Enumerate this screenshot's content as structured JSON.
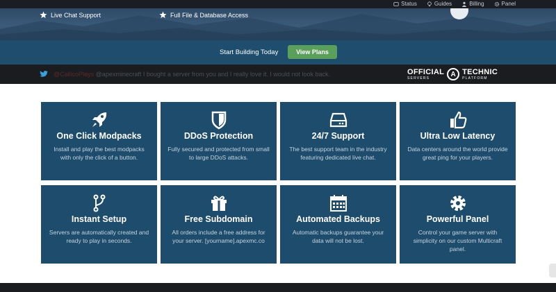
{
  "topnav": {
    "items": [
      {
        "label": "Status",
        "icon": "status-icon"
      },
      {
        "label": "Guides",
        "icon": "lightbulb-icon"
      },
      {
        "label": "Billing",
        "icon": "user-icon"
      },
      {
        "label": "Panel",
        "icon": "gear-icon"
      }
    ]
  },
  "hero": {
    "features": [
      {
        "label": "Live Chat Support",
        "icon": "star-icon"
      },
      {
        "label": "Full File & Database Access",
        "icon": "star-icon"
      }
    ]
  },
  "cta": {
    "text": "Start Building Today",
    "button_label": "View Plans",
    "button_color": "#5aa05a"
  },
  "tweet": {
    "handle": "@CallicoPlays",
    "text": "@apexminecraft I bought a server from you and I really love it. I would not look back."
  },
  "brand": {
    "word1": "OFFICIAL",
    "word1_sub": "SERVERS",
    "badge": "A",
    "word2": "TECHNIC",
    "word2_sub": "PLATFORM"
  },
  "features": [
    {
      "title": "One Click Modpacks",
      "desc": "Install and play the best modpacks with only the click of a button.",
      "icon": "rocket-icon"
    },
    {
      "title": "DDoS Protection",
      "desc": "Fully secured and protected from small to large DDoS attacks.",
      "icon": "shield-icon"
    },
    {
      "title": "24/7 Support",
      "desc": "The best support team in the industry featuring dedicated live chat.",
      "icon": "server-drive-icon"
    },
    {
      "title": "Ultra Low Latency",
      "desc": "Data centers around the world provide great ping for your players.",
      "icon": "thumbs-up-icon"
    },
    {
      "title": "Instant Setup",
      "desc": "Servers are automatically created and ready to play in seconds.",
      "icon": "branch-icon"
    },
    {
      "title": "Free Subdomain",
      "desc": "All orders include a free address for your server. [yourname].apexmc.co",
      "icon": "gift-icon"
    },
    {
      "title": "Automated Backups",
      "desc": "Automatic backups guarantee your data will not be lost.",
      "icon": "calendar-icon"
    },
    {
      "title": "Powerful Panel",
      "desc": "Control your game server with simplicity on our custom Multicraft panel.",
      "icon": "gear-icon"
    }
  ],
  "colors": {
    "card_bg": "#1d4c6c",
    "cta_bar": "#1e4d6d",
    "dark_bar": "#1b1c1f"
  }
}
